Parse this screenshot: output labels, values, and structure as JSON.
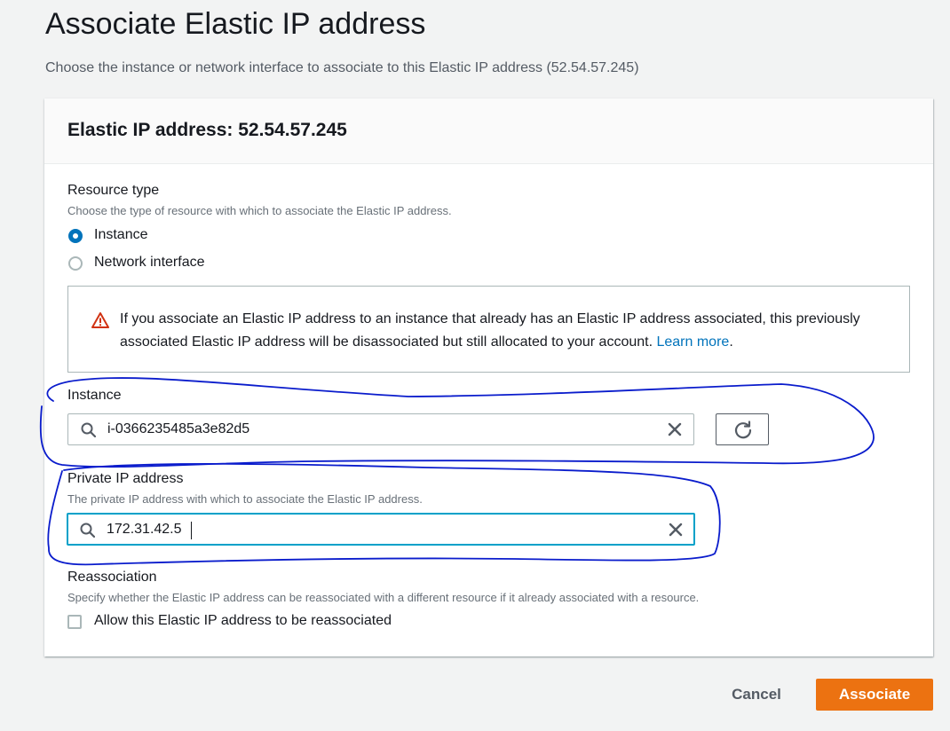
{
  "page": {
    "title": "Associate Elastic IP address",
    "description": "Choose the instance or network interface to associate to this Elastic IP address (52.54.57.245)"
  },
  "panel": {
    "title": "Elastic IP address: 52.54.57.245"
  },
  "resource_type": {
    "label": "Resource type",
    "hint": "Choose the type of resource with which to associate the Elastic IP address.",
    "options": [
      {
        "label": "Instance",
        "selected": true
      },
      {
        "label": "Network interface",
        "selected": false
      }
    ]
  },
  "alert": {
    "icon": "warning-icon",
    "text": "If you associate an Elastic IP address to an instance that already has an Elastic IP address associated, this previously associated Elastic IP address will be disassociated but still allocated to your account.",
    "link": "Learn more",
    "suffix": "."
  },
  "instance": {
    "label": "Instance",
    "value": "i-0366235485a3e82d5"
  },
  "private_ip": {
    "label": "Private IP address",
    "hint": "The private IP address with which to associate the Elastic IP address.",
    "value": "172.31.42.5"
  },
  "reassociation": {
    "label": "Reassociation",
    "hint": "Specify whether the Elastic IP address can be reassociated with a different resource if it already associated with a resource.",
    "checkbox_label": "Allow this Elastic IP address to be reassociated",
    "checked": false
  },
  "footer": {
    "cancel_label": "Cancel",
    "associate_label": "Associate"
  },
  "colors": {
    "primary": "#ec7211",
    "link": "#0073bb",
    "focus": "#00a1c9",
    "warning": "#d13212",
    "annotation": "#0000cc"
  }
}
